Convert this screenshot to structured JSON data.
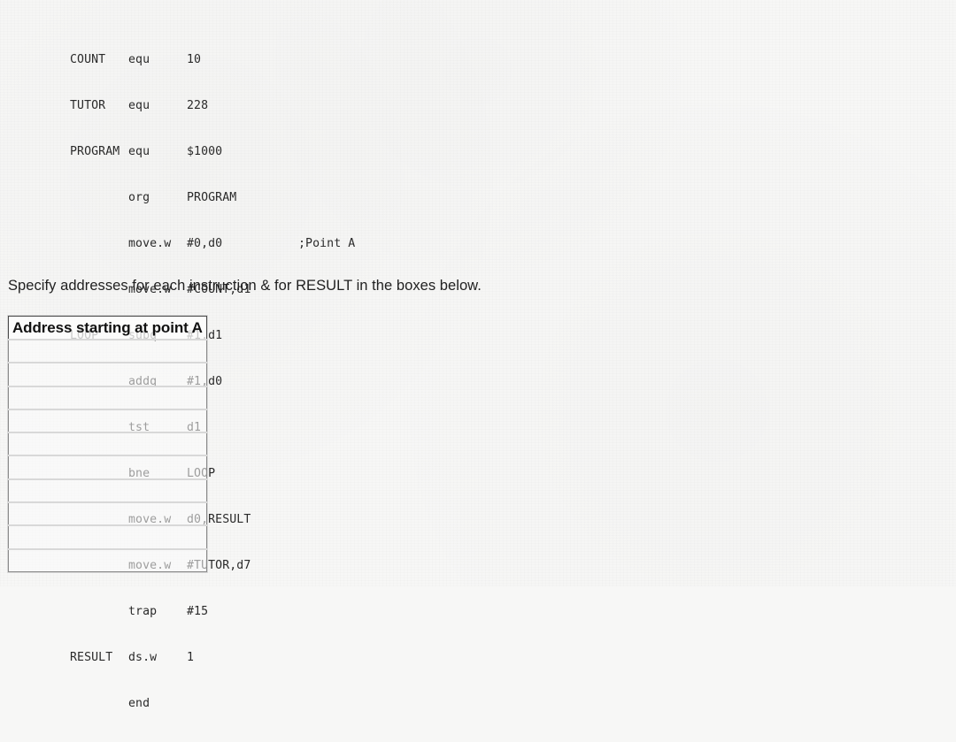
{
  "page": {
    "background_color": "#f7f7f6",
    "text_color": "#2a2a2a"
  },
  "code_listing": {
    "lines": [
      {
        "label": "COUNT",
        "mnemonic": "equ",
        "operands": "10",
        "comment": ""
      },
      {
        "label": "TUTOR",
        "mnemonic": "equ",
        "operands": "228",
        "comment": ""
      },
      {
        "label": "PROGRAM",
        "mnemonic": "equ",
        "operands": "$1000",
        "comment": ""
      },
      {
        "label": "",
        "mnemonic": "org",
        "operands": "PROGRAM",
        "comment": ""
      },
      {
        "label": "",
        "mnemonic": "move.w",
        "operands": "#0,d0",
        "comment": ";Point A"
      },
      {
        "label": "",
        "mnemonic": "move.w",
        "operands": "#COUNT,d1",
        "comment": ""
      },
      {
        "label": "LOOP",
        "mnemonic": "subq",
        "operands": "#1,d1",
        "comment": ""
      },
      {
        "label": "",
        "mnemonic": "addq",
        "operands": "#1,d0",
        "comment": ""
      },
      {
        "label": "",
        "mnemonic": "tst",
        "operands": "d1",
        "comment": ""
      },
      {
        "label": "",
        "mnemonic": "bne",
        "operands": "LOOP",
        "comment": ""
      },
      {
        "label": "",
        "mnemonic": "move.w",
        "operands": "d0,RESULT",
        "comment": ""
      },
      {
        "label": "",
        "mnemonic": "move.w",
        "operands": "#TUTOR,d7",
        "comment": ""
      },
      {
        "label": "",
        "mnemonic": "trap",
        "operands": "#15",
        "comment": ""
      },
      {
        "label": "RESULT",
        "mnemonic": "ds.w",
        "operands": "1",
        "comment": ""
      },
      {
        "label": "",
        "mnemonic": "end",
        "operands": "",
        "comment": ""
      }
    ]
  },
  "instruction": {
    "text": "Specify addresses for each instruction & for RESULT in the boxes below."
  },
  "answer_table": {
    "header": "Address starting at point A",
    "rows": [
      "",
      "",
      "",
      "",
      "",
      "",
      "",
      "",
      "",
      ""
    ]
  }
}
